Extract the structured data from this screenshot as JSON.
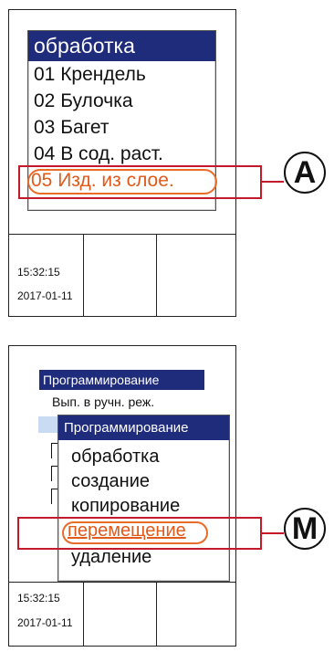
{
  "panel_a": {
    "menu_title": "обработка",
    "items": [
      "01 Крендель",
      "02 Булочка",
      "03 Багет",
      "04 В сод. раст.",
      "05 Изд. из слое."
    ],
    "time": "15:32:15",
    "date": "2017-01-11",
    "callout": "A"
  },
  "panel_m": {
    "bg_title": "Программирование",
    "bg_item": "Вып. в ручн. реж.",
    "popup_title": "Программирование",
    "items": [
      "обработка",
      "создание",
      "копирование",
      "перемещение",
      "удаление"
    ],
    "time": "15:32:15",
    "date": "2017-01-11",
    "callout": "M"
  },
  "colors": {
    "title_bg": "#1f2b7b",
    "highlight": "#e05a1c",
    "callout_frame": "#c21a2a"
  }
}
